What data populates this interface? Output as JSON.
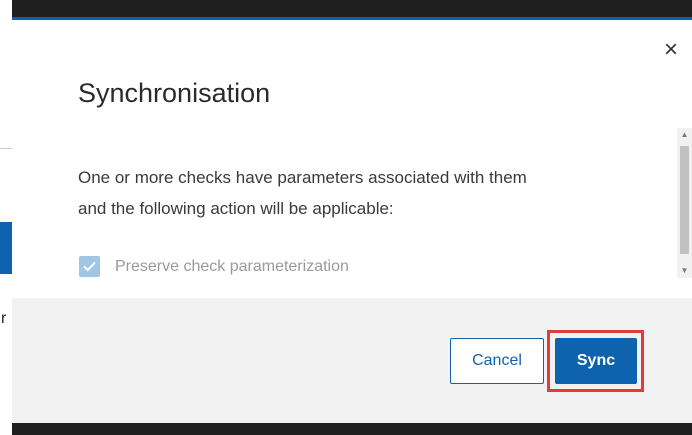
{
  "dialog": {
    "title": "Synchronisation",
    "body_line1": "One or more checks have parameters associated with them",
    "body_line2": "and the following action will be applicable:",
    "checkbox": {
      "label": "Preserve check parameterization",
      "checked": true
    },
    "close_symbol": "×",
    "icons": {
      "close": "close-icon",
      "check": "checkmark-icon",
      "scroll_up": "chevron-up-icon",
      "scroll_down": "chevron-down-icon"
    }
  },
  "footer": {
    "cancel_label": "Cancel",
    "sync_label": "Sync"
  },
  "colors": {
    "accent": "#0f62ae",
    "highlight": "#e23b3b",
    "checkbox_disabled": "#9fc6e4"
  }
}
